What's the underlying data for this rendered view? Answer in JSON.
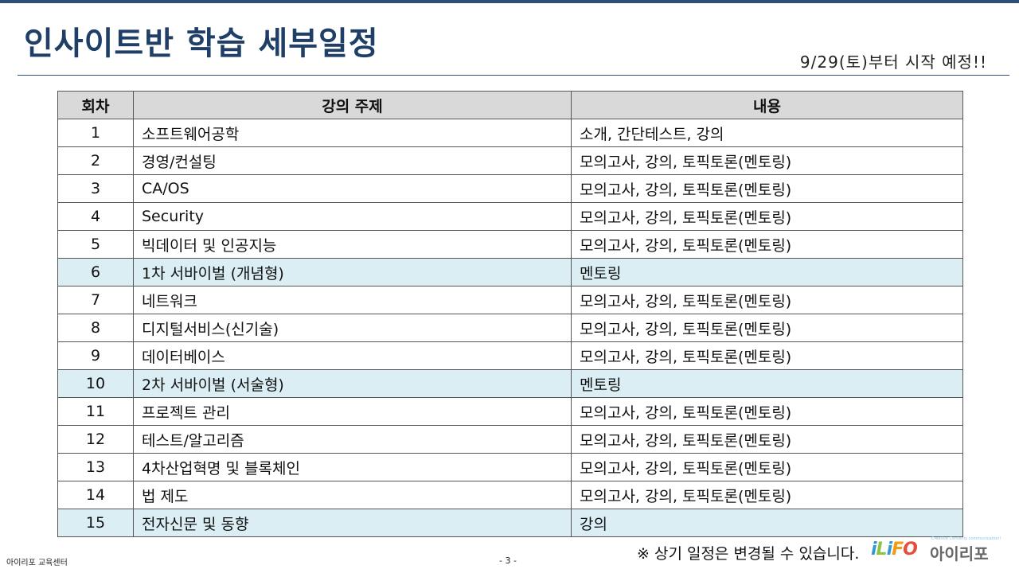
{
  "header": {
    "title": "인사이트반 학습 세부일정",
    "subtitle": "9/29(토)부터 시작 예정!!"
  },
  "table": {
    "columns": [
      "회차",
      "강의 주제",
      "내용"
    ],
    "rows": [
      {
        "no": "1",
        "topic": "소프트웨어공학",
        "content": "소개, 간단테스트, 강의",
        "highlight": false
      },
      {
        "no": "2",
        "topic": "경영/컨설팅",
        "content": "모의고사, 강의, 토픽토론(멘토링)",
        "highlight": false
      },
      {
        "no": "3",
        "topic": "CA/OS",
        "content": "모의고사, 강의, 토픽토론(멘토링)",
        "highlight": false
      },
      {
        "no": "4",
        "topic": "Security",
        "content": "모의고사, 강의, 토픽토론(멘토링)",
        "highlight": false
      },
      {
        "no": "5",
        "topic": "빅데이터 및 인공지능",
        "content": "모의고사, 강의, 토픽토론(멘토링)",
        "highlight": false
      },
      {
        "no": "6",
        "topic": "1차 서바이벌 (개념형)",
        "content": "멘토링",
        "highlight": true
      },
      {
        "no": "7",
        "topic": "네트워크",
        "content": "모의고사, 강의, 토픽토론(멘토링)",
        "highlight": false
      },
      {
        "no": "8",
        "topic": "디지털서비스(신기술)",
        "content": "모의고사, 강의, 토픽토론(멘토링)",
        "highlight": false
      },
      {
        "no": "9",
        "topic": "데이터베이스",
        "content": "모의고사, 강의, 토픽토론(멘토링)",
        "highlight": false
      },
      {
        "no": "10",
        "topic": "2차 서바이벌 (서술형)",
        "content": "멘토링",
        "highlight": true
      },
      {
        "no": "11",
        "topic": "프로젝트 관리",
        "content": "모의고사, 강의, 토픽토론(멘토링)",
        "highlight": false
      },
      {
        "no": "12",
        "topic": "테스트/알고리즘",
        "content": "모의고사, 강의, 토픽토론(멘토링)",
        "highlight": false
      },
      {
        "no": "13",
        "topic": "4차산업혁명 및 블록체인",
        "content": "모의고사, 강의, 토픽토론(멘토링)",
        "highlight": false
      },
      {
        "no": "14",
        "topic": "법 제도",
        "content": "모의고사, 강의, 토픽토론(멘토링)",
        "highlight": false
      },
      {
        "no": "15",
        "topic": "전자신문 및 동향",
        "content": "강의",
        "highlight": true
      }
    ]
  },
  "footer": {
    "org": "아이리포 교육센터",
    "page": "- 3 -",
    "note": "※ 상기 일정은 변경될 수 있습니다."
  },
  "logo": {
    "en_letters": [
      "i",
      "L",
      "i",
      "F",
      "O"
    ],
    "ko": "아이리포",
    "tagline": "Creative Contents communication!"
  }
}
